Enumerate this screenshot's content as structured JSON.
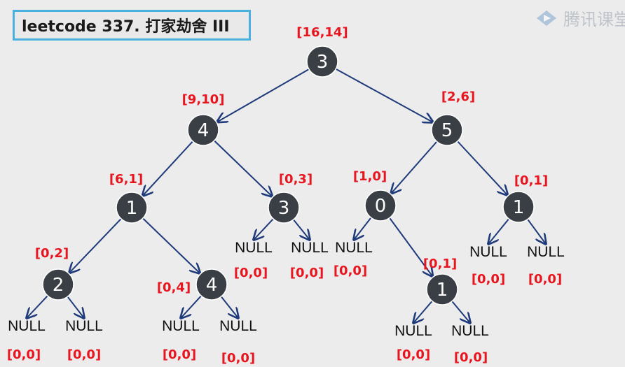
{
  "title": "leetcode 337. 打家劫舍 III",
  "watermark": {
    "text": "腾讯课堂",
    "icon": "play-logo-icon"
  },
  "colors": {
    "node_fill": "#3a3f45",
    "dp_label": "#e8141e",
    "edge": "#1e3a7a",
    "title_border": "#4ab0e0"
  },
  "null_label": "NULL",
  "nodes": [
    {
      "id": "root",
      "value": "3",
      "dp": "[16,14]"
    },
    {
      "id": "n4",
      "value": "4",
      "dp": "[9,10]"
    },
    {
      "id": "n5",
      "value": "5",
      "dp": "[2,6]"
    },
    {
      "id": "n1a",
      "value": "1",
      "dp": "[6,1]"
    },
    {
      "id": "n3",
      "value": "3",
      "dp": "[0,3]"
    },
    {
      "id": "n0",
      "value": "0",
      "dp": "[1,0]"
    },
    {
      "id": "n1b",
      "value": "1",
      "dp": "[0,1]"
    },
    {
      "id": "n2",
      "value": "2",
      "dp": "[0,2]"
    },
    {
      "id": "n4b",
      "value": "4",
      "dp": "[0,4]"
    },
    {
      "id": "n1c",
      "value": "1",
      "dp": "[0,1]"
    }
  ],
  "null_leaves": [
    {
      "id": "nl1",
      "dp": "[0,0]"
    },
    {
      "id": "nl2",
      "dp": "[0,0]"
    },
    {
      "id": "nl3",
      "dp": "[0,0]"
    },
    {
      "id": "nl4",
      "dp": "[0,0]"
    },
    {
      "id": "nl5",
      "dp": "[0,0]"
    },
    {
      "id": "nl6",
      "dp": "[0,0]"
    },
    {
      "id": "nl7",
      "dp": "[0,0]"
    },
    {
      "id": "nl8",
      "dp": "[0,0]"
    },
    {
      "id": "nl9",
      "dp": "[0,0]"
    },
    {
      "id": "nl10",
      "dp": "[0,0]"
    },
    {
      "id": "nl11",
      "dp": "[0,0]"
    }
  ],
  "edges": [
    [
      "root",
      "n4"
    ],
    [
      "root",
      "n5"
    ],
    [
      "n4",
      "n1a"
    ],
    [
      "n4",
      "n3"
    ],
    [
      "n5",
      "n0"
    ],
    [
      "n5",
      "n1b"
    ],
    [
      "n1a",
      "n2"
    ],
    [
      "n1a",
      "n4b"
    ],
    [
      "n3",
      "nl3"
    ],
    [
      "n3",
      "nl4"
    ],
    [
      "n0",
      "nl5"
    ],
    [
      "n0",
      "n1c"
    ],
    [
      "n1b",
      "nl10"
    ],
    [
      "n1b",
      "nl11"
    ],
    [
      "n2",
      "nl1"
    ],
    [
      "n2",
      "nl2"
    ],
    [
      "n4b",
      "nl6"
    ],
    [
      "n4b",
      "nl7"
    ],
    [
      "n1c",
      "nl8"
    ],
    [
      "n1c",
      "nl9"
    ]
  ]
}
